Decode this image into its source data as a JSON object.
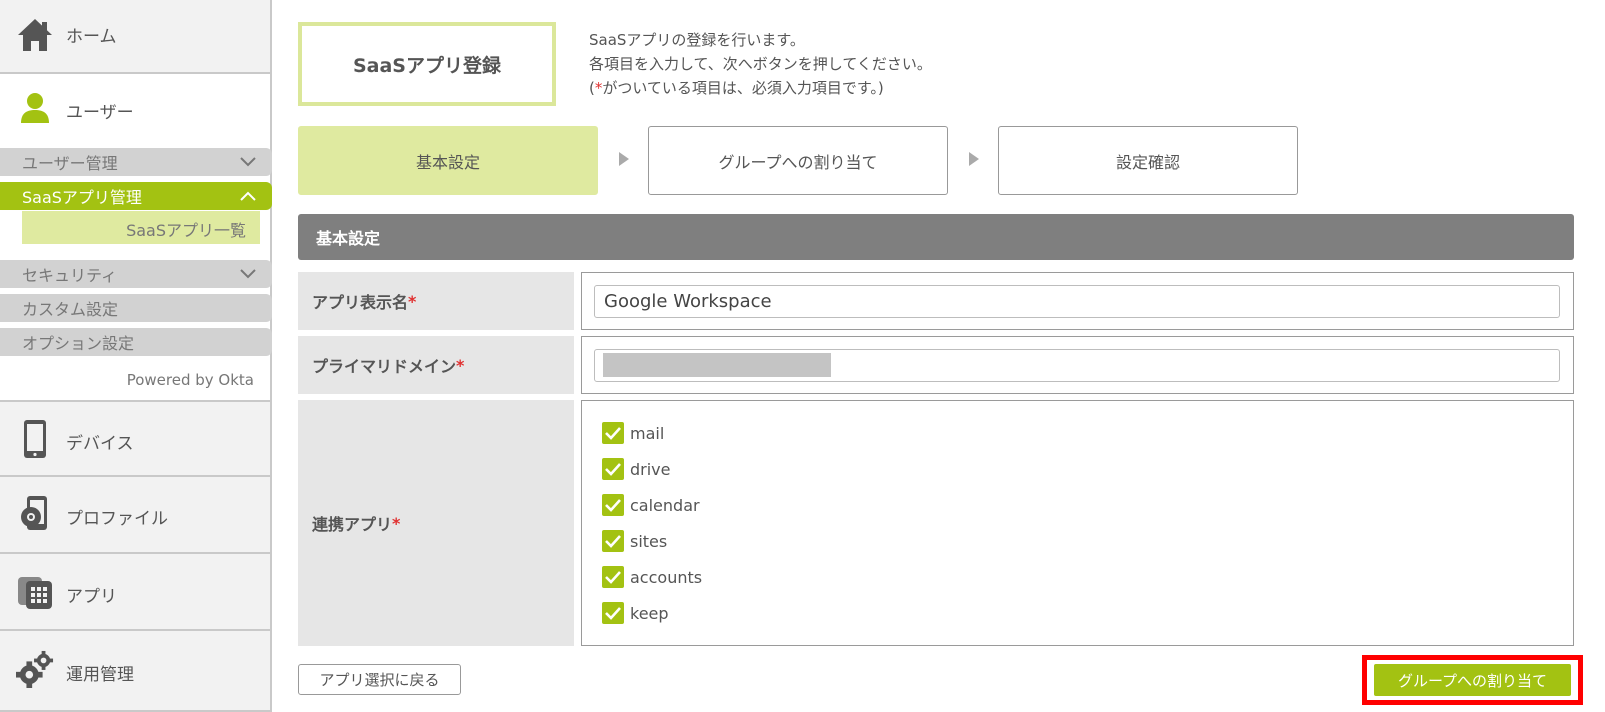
{
  "sidebar": {
    "home": "ホーム",
    "users": "ユーザー",
    "user_menu": [
      {
        "label": "ユーザー管理",
        "chevron": "chevron-down"
      },
      {
        "label": "SaaSアプリ管理",
        "chevron": "chevron-up",
        "active": true
      },
      {
        "label": "SaaSアプリ一覧",
        "child": true
      },
      {
        "label": "セキュリティ",
        "chevron": "chevron-down"
      },
      {
        "label": "カスタム設定"
      },
      {
        "label": "オプション設定"
      }
    ],
    "powered_by": "Powered by Okta",
    "device": "デバイス",
    "profile": "プロファイル",
    "apps": "アプリ",
    "operations": "運用管理"
  },
  "page": {
    "title": "SaaSアプリ登録",
    "description": [
      "SaaSアプリの登録を行います。",
      "各項目を入力して、次へボタンを押してください。"
    ],
    "req_note": {
      "open": "(",
      "mark": "*",
      "text": "がついている項目は、必須入力項目です。)"
    }
  },
  "steps": [
    {
      "label": "基本設定",
      "current": true
    },
    {
      "label": "グループへの割り当て"
    },
    {
      "label": "設定確認"
    }
  ],
  "section": {
    "title": "基本設定"
  },
  "form": {
    "app_name": {
      "label": "アプリ表示名",
      "required_mark": "*",
      "value": "Google Workspace"
    },
    "primary_domain": {
      "label": "プライマリドメイン",
      "required_mark": "*"
    },
    "linked_apps": {
      "label": "連携アプリ",
      "required_mark": "*",
      "options": [
        {
          "label": "mail",
          "checked": true
        },
        {
          "label": "drive",
          "checked": true
        },
        {
          "label": "calendar",
          "checked": true
        },
        {
          "label": "sites",
          "checked": true
        },
        {
          "label": "accounts",
          "checked": true
        },
        {
          "label": "keep",
          "checked": true
        }
      ]
    }
  },
  "buttons": {
    "back": "アプリ選択に戻る",
    "next": "グループへの割り当て"
  },
  "colors": {
    "accent": "#a3c212",
    "accent_light": "#dfeaa0",
    "section_head": "#7f7f7f",
    "highlight": "#ff0000"
  }
}
